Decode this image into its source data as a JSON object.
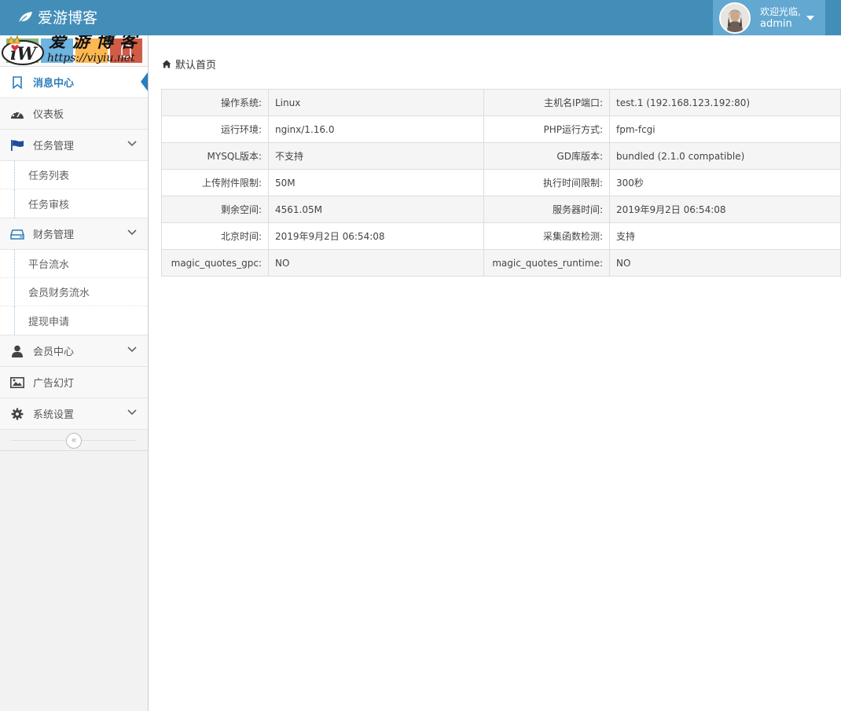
{
  "header": {
    "brand": "爱游博客",
    "welcome": "欢迎光临,",
    "username": "admin"
  },
  "watermark": {
    "text": "爱游博客",
    "url": "https://viyiu.net"
  },
  "sidebar": {
    "items": [
      {
        "label": "消息中心",
        "icon": "bookmark-icon"
      },
      {
        "label": "仪表板",
        "icon": "dashboard-icon"
      },
      {
        "label": "任务管理",
        "icon": "flag-icon",
        "sub": [
          "任务列表",
          "任务审核"
        ]
      },
      {
        "label": "财务管理",
        "icon": "hdd-icon",
        "sub": [
          "平台流水",
          "会员财务流水",
          "提现申请"
        ]
      },
      {
        "label": "会员中心",
        "icon": "user-icon"
      },
      {
        "label": "广告幻灯",
        "icon": "picture-icon"
      },
      {
        "label": "系统设置",
        "icon": "cog-icon"
      }
    ],
    "collapse_glyph": "«"
  },
  "breadcrumb": {
    "label": "默认首页"
  },
  "info_rows": [
    {
      "k1": "操作系统:",
      "v1": "Linux",
      "k2": "主机名IP端口:",
      "v2": "test.1 (192.168.123.192:80)"
    },
    {
      "k1": "运行环境:",
      "v1": "nginx/1.16.0",
      "k2": "PHP运行方式:",
      "v2": "fpm-fcgi"
    },
    {
      "k1": "MYSQL版本:",
      "v1": "不支持",
      "k2": "GD库版本:",
      "v2": "bundled (2.1.0 compatible)"
    },
    {
      "k1": "上传附件限制:",
      "v1": "50M",
      "k2": "执行时间限制:",
      "v2": "300秒"
    },
    {
      "k1": "剩余空间:",
      "v1": "4561.05M",
      "k2": "服务器时间:",
      "v2": "2019年9月2日 06:54:08"
    },
    {
      "k1": "北京时间:",
      "v1": "2019年9月2日 06:54:08",
      "k2": "采集函数检测:",
      "v2": "支持"
    },
    {
      "k1": "magic_quotes_gpc:",
      "v1": "NO",
      "k2": "magic_quotes_runtime:",
      "v2": "NO"
    }
  ],
  "colors": {
    "navbar": "#438eb9",
    "userbox": "#62a8d1",
    "active": "#2b7dbc",
    "shortcut_green": "#87b87f",
    "shortcut_blue": "#6fb3e0",
    "shortcut_orange": "#ffb752",
    "shortcut_red": "#d15b47"
  }
}
